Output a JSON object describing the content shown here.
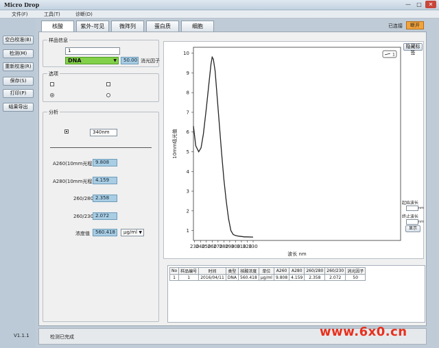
{
  "window": {
    "title": "Micro Drop",
    "min": "—",
    "max": "□",
    "close": "✕"
  },
  "menu": [
    {
      "label": "文件(F)"
    },
    {
      "label": "工具(T)"
    },
    {
      "label": "诊断(D)"
    }
  ],
  "sidebar": {
    "buttons": [
      "空白校准(B)",
      "检测(M)",
      "重新校准(R)",
      "保存(S)",
      "打印(P)",
      "结果导出"
    ],
    "version": "V1.1.1"
  },
  "tabs": [
    "核酸",
    "紫外-可见",
    "微阵列",
    "蛋白质",
    "细胞"
  ],
  "connection": {
    "status_label": "已连接",
    "button_label": "断开"
  },
  "sample_info": {
    "group_label": "样品信息",
    "sample_id": "1",
    "sample_type": "DNA",
    "extinction_value": "50.00",
    "extinction_label": "消光因子"
  },
  "options": {
    "group_label": "选项"
  },
  "analysis": {
    "group_label": "分析",
    "wavelength_value": "340nm",
    "fields": [
      {
        "label": "A260(10mm光程)",
        "value": "9.808"
      },
      {
        "label": "A280(10mm光程)",
        "value": "4.159"
      },
      {
        "label": "260/280",
        "value": "2.358"
      },
      {
        "label": "260/230",
        "value": "2.072"
      },
      {
        "label": "浓度值",
        "value": "560.418"
      }
    ],
    "unit": "μg/ml"
  },
  "chart_controls": {
    "hide_label_button": "隐藏标签",
    "legend_sample": "1",
    "start_wavelength_label": "起始波长",
    "end_wavelength_label": "终止波长",
    "nm_unit": "nm",
    "display_button": "显示"
  },
  "chart_data": {
    "type": "line",
    "xlabel": "波长 nm",
    "ylabel": "10mm吸光值",
    "xlim": [
      228,
      582
    ],
    "ylim": [
      0.5,
      10.3
    ],
    "xticks": [
      230,
      240,
      250,
      260,
      270,
      280,
      290,
      300,
      310,
      320,
      330
    ],
    "yticks": [
      1,
      2,
      3,
      4,
      5,
      6,
      7,
      8,
      9,
      10
    ],
    "grid": false,
    "series": [
      {
        "name": "1",
        "color": "#222222",
        "x": [
          228,
          232,
          237,
          241,
          245,
          250,
          255,
          258,
          260,
          262,
          265,
          268,
          272,
          276,
          280,
          284,
          288,
          292,
          296,
          300,
          305,
          310,
          315,
          320,
          330
        ],
        "y": [
          6.3,
          5.3,
          5.0,
          5.2,
          5.9,
          7.2,
          8.6,
          9.45,
          9.8,
          9.7,
          9.1,
          8.0,
          6.5,
          5.0,
          3.6,
          2.5,
          1.6,
          1.0,
          0.8,
          0.75,
          0.72,
          0.7,
          0.68,
          0.68,
          0.67
        ]
      }
    ]
  },
  "results": {
    "headers": [
      "No",
      "样品编号",
      "时间",
      "类型",
      "核酸浓度",
      "单位",
      "A260",
      "A280",
      "260/280",
      "260/230",
      "消光因子"
    ],
    "rows": [
      [
        "1",
        "1",
        "2016/04/11",
        "DNA",
        "560.418",
        "μg/ml",
        "9.808",
        "4.159",
        "2.358",
        "2.072",
        "50"
      ]
    ]
  },
  "status": {
    "text": "检测已完成"
  },
  "watermark": "www.6x0.cn"
}
